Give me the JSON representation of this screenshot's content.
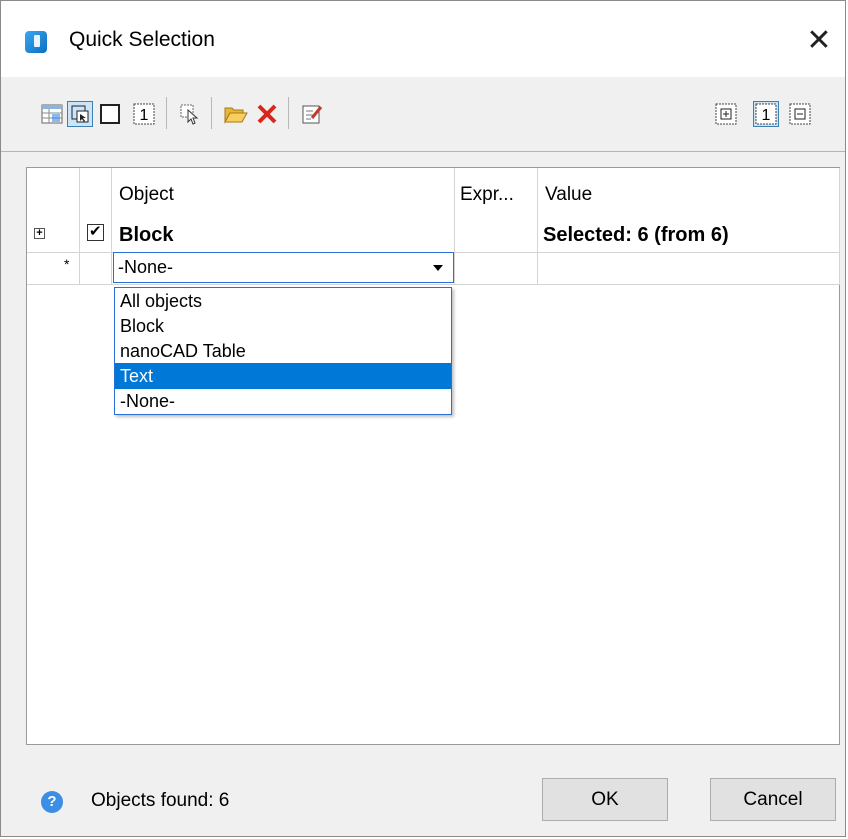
{
  "window": {
    "title": "Quick Selection",
    "close_glyph": "✕"
  },
  "toolbar": {
    "left_icons": [
      "table-view-icon",
      "select-window-icon",
      "empty-frame-icon",
      "single-object-icon",
      "pick-objects-icon",
      "open-folder-icon",
      "delete-icon",
      "edit-properties-icon"
    ],
    "right_icons": [
      "expand-all-icon",
      "single-view-icon",
      "collapse-all-icon"
    ],
    "single_label": "1",
    "expand_label": "+",
    "collapse_label": "−"
  },
  "grid": {
    "columns": {
      "object": "Object",
      "expression": "Expr...",
      "value": "Value"
    },
    "row1": {
      "expand": "+",
      "check": "✔",
      "object": "Block",
      "value": "Selected: 6 (from 6)"
    },
    "new_row": {
      "marker": "*",
      "selected_value": "-None-"
    },
    "dropdown_options": [
      "All objects",
      "Block",
      "nanoCAD Table",
      "Text",
      "-None-"
    ],
    "highlighted_option": "Text"
  },
  "footer": {
    "help_glyph": "?",
    "status": "Objects found: 6",
    "ok_label": "OK",
    "cancel_label": "Cancel"
  },
  "colors": {
    "accent": "#0078d7",
    "border_focus": "#2a6fd6",
    "pressed_bg": "#cce4f7"
  }
}
